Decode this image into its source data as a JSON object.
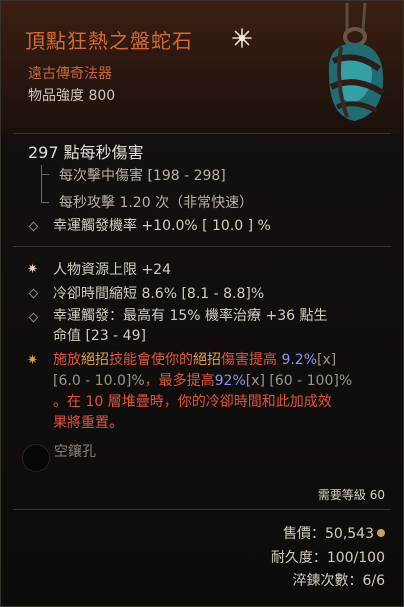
{
  "item": {
    "name": "頂點狂熱之盤蛇石",
    "rarity_type": "遠古傳奇法器",
    "item_power": "物品強度 800"
  },
  "damage": {
    "dps": "297 點每秒傷害",
    "per_hit": "每次擊中傷害 [198 - 298]",
    "attack_speed": "每秒攻擊 1.20 次（非常快速）",
    "lucky_hit_chance": "幸運觸發機率 +10.0% [ 10.0 ] %"
  },
  "affixes": {
    "resource": "人物資源上限 +24",
    "cooldown": "冷卻時間縮短 8.6% [8.1 - 8.8]%",
    "lucky_hit_line1": "幸運觸發：最高有 15% 機率治療 +36 點生",
    "lucky_hit_line2": "命值 [23 - 49]"
  },
  "aspect": {
    "p1": "施放",
    "p2": "絕招",
    "p3": "技能會使你的",
    "p4": "絕招",
    "p5": "傷害提高",
    "p6": "9.2%",
    "p7": "[x]",
    "p8": "[6.0 - 10.0]%",
    "p9": "，最多提高",
    "p10": "92%",
    "p11": "[x]",
    "p12": "[60 - 100]%",
    "line3": "。在 10 層堆疊時，你的冷卻時間和此加成效",
    "line4": "果將重置。"
  },
  "socket": {
    "label": "空鑲孔"
  },
  "requirements": {
    "level": "需要等級 60"
  },
  "footer": {
    "sell_value": "售價：50,543",
    "durability": "耐久度：100/100",
    "temper": "淬鍊次數：6/6"
  },
  "colors": {
    "title": "#d26b36",
    "aspect": "#e8a033",
    "highlight_red": "#e0533b",
    "highlight_blue": "#8d92f2"
  },
  "icons": [
    "ancestral-sparkle-icon",
    "diamond-bullet-icon",
    "star-bullet-icon",
    "coin-icon",
    "empty-socket-icon"
  ]
}
